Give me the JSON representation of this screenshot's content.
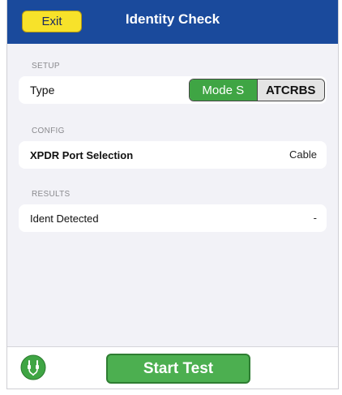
{
  "header": {
    "exit_label": "Exit",
    "title": "Identity Check"
  },
  "setup": {
    "section_label": "SETUP",
    "type_label": "Type",
    "options": [
      "Mode S",
      "ATCRBS"
    ],
    "selected": "Mode S"
  },
  "config": {
    "section_label": "CONFIG",
    "port_label": "XPDR Port Selection",
    "port_value": "Cable"
  },
  "results": {
    "section_label": "RESULTS",
    "ident_label": "Ident Detected",
    "ident_value": "-"
  },
  "footer": {
    "start_label": "Start Test",
    "connection_icon": "connector-icon"
  },
  "colors": {
    "header": "#1a4a9c",
    "exit": "#f7e22a",
    "accent_green": "#3fa544"
  }
}
